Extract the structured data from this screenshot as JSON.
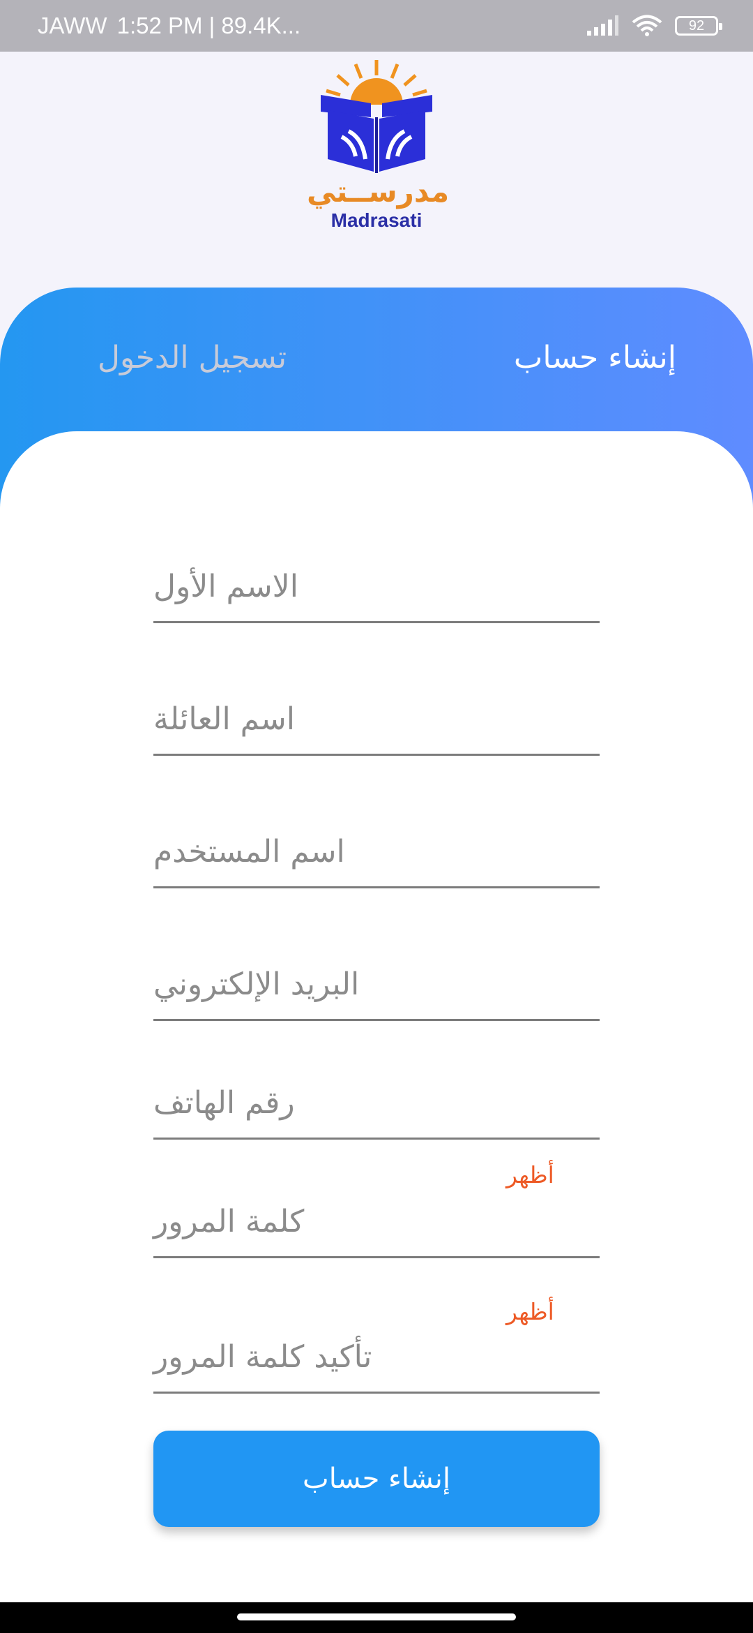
{
  "status_bar": {
    "carrier": "JAWW",
    "time": "1:52 PM | 89.4K...",
    "battery": "92",
    "signal_icon": "signal-icon",
    "wifi_icon": "wifi-icon"
  },
  "logo": {
    "arabic": "مدرســتي",
    "latin": "Madrasati",
    "colors": {
      "book": "#2b2fd8",
      "sun": "#f0931f"
    }
  },
  "tabs": {
    "signup": "إنشاء حساب",
    "login": "تسجيل الدخول"
  },
  "form": {
    "fields": [
      {
        "name": "first-name",
        "placeholder": "الاسم الأول"
      },
      {
        "name": "last-name",
        "placeholder": "اسم العائلة"
      },
      {
        "name": "username",
        "placeholder": "اسم المستخدم"
      },
      {
        "name": "email",
        "placeholder": "البريد الإلكتروني"
      },
      {
        "name": "phone",
        "placeholder": "رقم الهاتف"
      },
      {
        "name": "password",
        "placeholder": "كلمة المرور",
        "toggle": "أظهر"
      },
      {
        "name": "confirm-password",
        "placeholder": "تأكيد كلمة المرور",
        "toggle": "أظهر"
      }
    ],
    "submit_label": "إنشاء حساب"
  },
  "colors": {
    "accent": "#2196f3",
    "gradient_start": "#2497f1",
    "gradient_end": "#5f8cff",
    "toggle": "#ed5a26"
  }
}
